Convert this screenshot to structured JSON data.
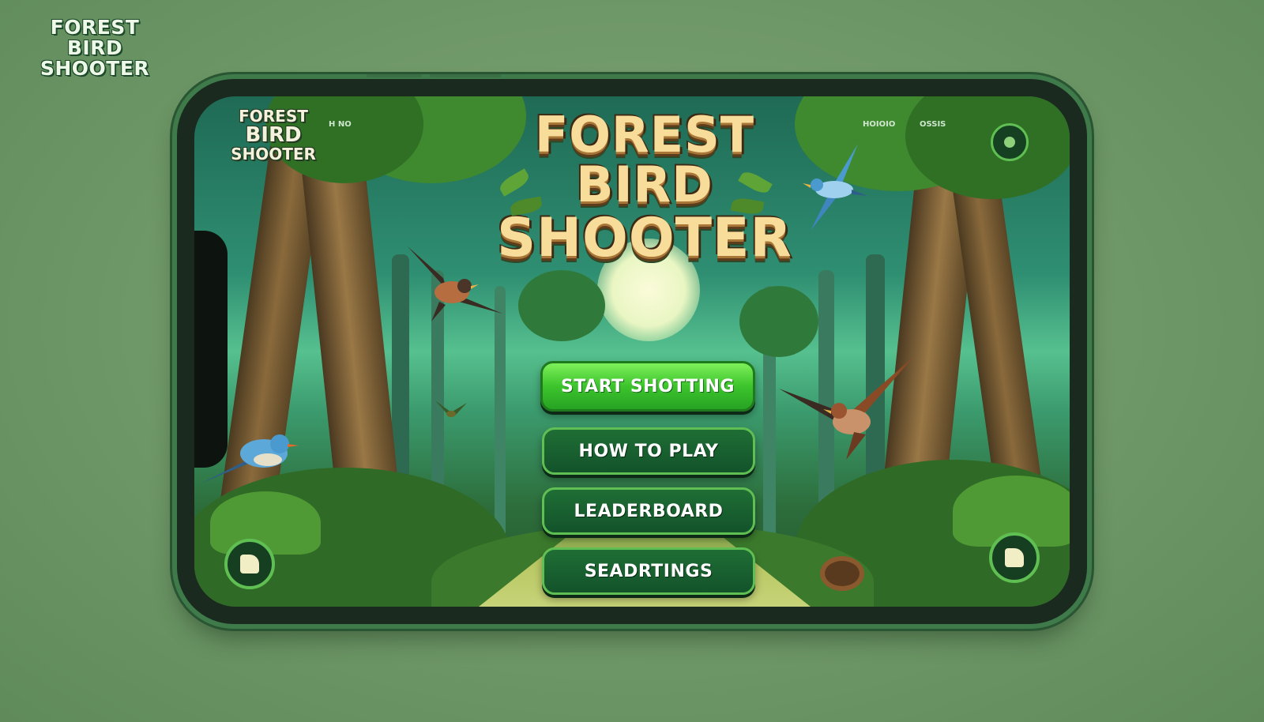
{
  "brand": {
    "corner_logo": [
      "FOREST",
      "BIRD",
      "SHOOTER"
    ]
  },
  "screen": {
    "small_logo": [
      "FOREST",
      "BIRD",
      "SHOOTER"
    ],
    "tiny_labels": [
      "H NO",
      "HOIOIO",
      "OSSIS"
    ],
    "title": [
      "FOREST",
      "BIRD",
      "SHOOTER"
    ],
    "menu": {
      "start": "START SHOTTING",
      "how_to_play": "HOW TO PLAY",
      "leaderboard": "LEADERBOARD",
      "settings": "SEADRTINGS"
    }
  },
  "colors": {
    "background": "#6f9868",
    "phone_frame": "#3e7a4a",
    "primary_button": "#3cc42c",
    "secondary_button": "#13532a",
    "title_text": "#f7dc9a"
  },
  "icons": {
    "top_right": "settings-circle-icon",
    "bottom_left": "play-circle-icon",
    "bottom_right": "sound-circle-icon"
  }
}
